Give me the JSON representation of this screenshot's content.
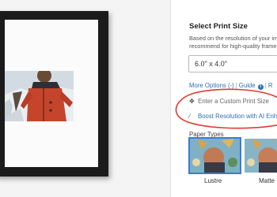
{
  "print_size": {
    "title": "Select Print Size",
    "description_lines": [
      "Based on the resolution of your image, we",
      "recommend for high-quality frame"
    ],
    "selected_size": "6.0\" x 4.0\""
  },
  "links": {
    "more_options": "More Options (-)",
    "separator": "|",
    "guide": "Guide",
    "guide_icon": "info-icon",
    "reset_partial": "R"
  },
  "custom_size": {
    "icon": "move-icon",
    "label": "Enter a Custom Print Size"
  },
  "boost": {
    "icon": "wand-icon",
    "label": "Boost Resolution with AI Enhance"
  },
  "paper": {
    "label": "Paper Types",
    "options": [
      {
        "name": "Lustre",
        "selected": true
      },
      {
        "name": "Matte",
        "selected": false
      }
    ]
  },
  "colors": {
    "link": "#2e6fb4",
    "highlight": "#e03a2f",
    "selected_outline": "#3a7bd5",
    "frame": "#1b1b1b"
  }
}
